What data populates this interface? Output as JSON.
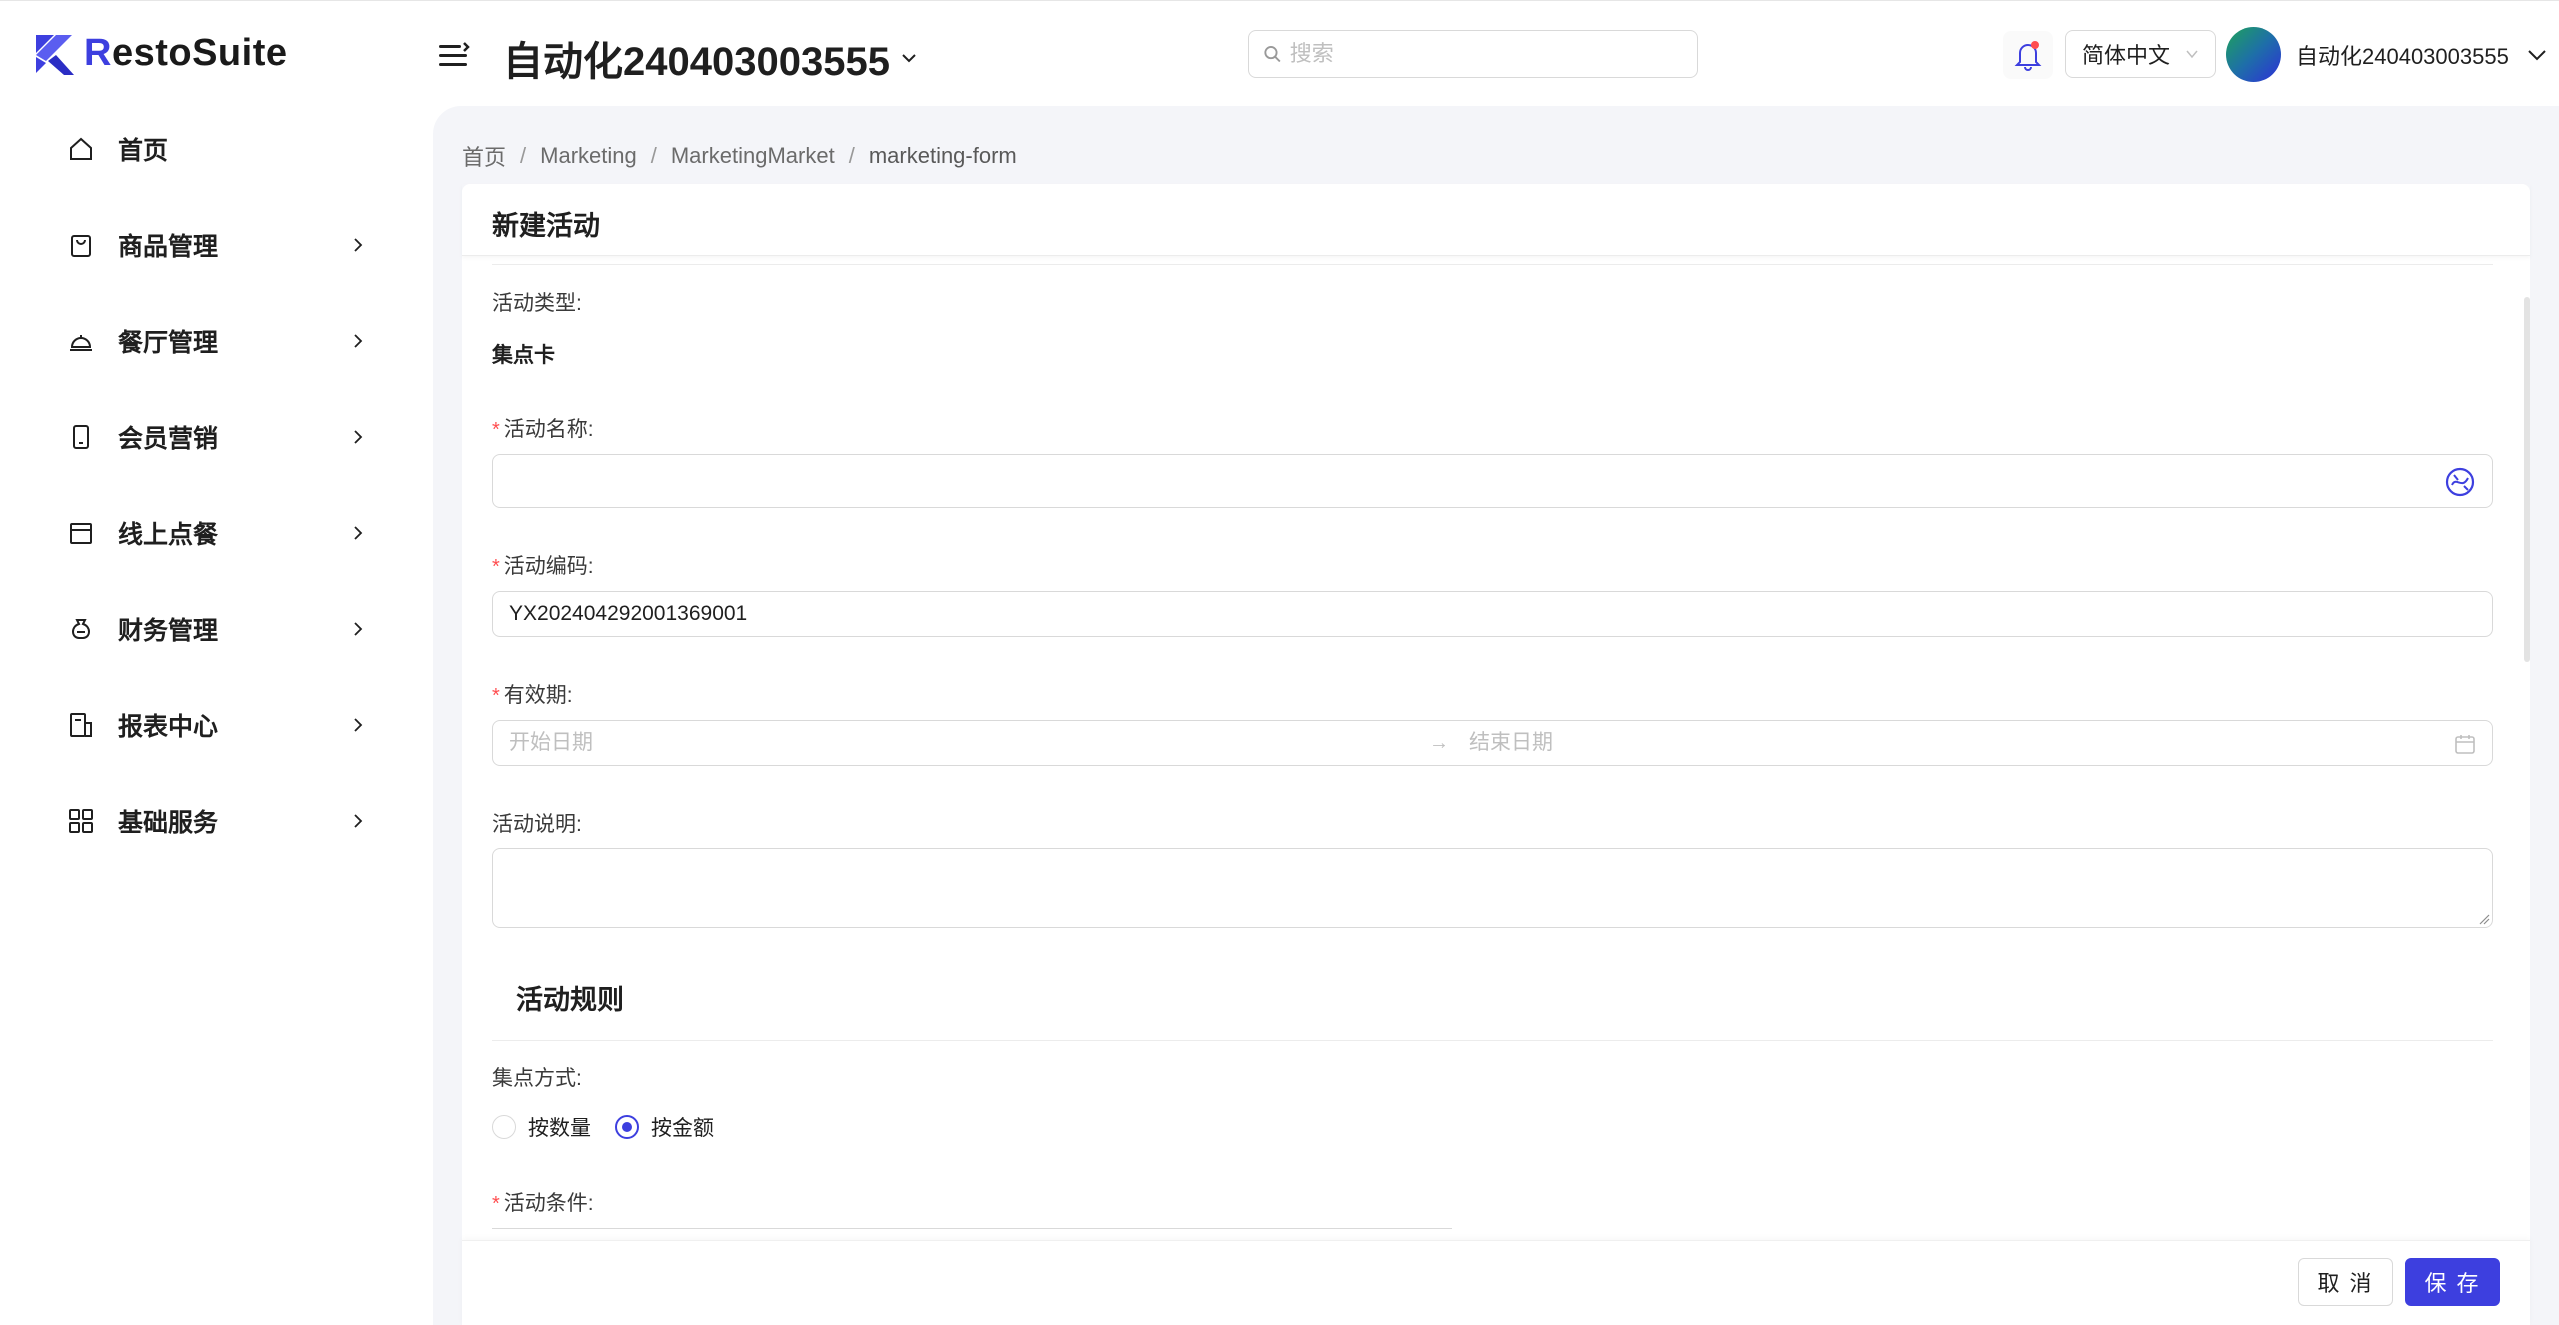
{
  "app": {
    "logo_text_accent": "R",
    "logo_text_rest": "estoSuite",
    "tenant_name": "自动化240403003555",
    "brand_color": "#3d3fdf"
  },
  "header": {
    "search_placeholder": "搜索",
    "language": "简体中文",
    "user_name": "自动化240403003555"
  },
  "sidebar": {
    "items": [
      {
        "label": "首页",
        "icon": "home-icon"
      },
      {
        "label": "商品管理",
        "icon": "shopping-bag-icon"
      },
      {
        "label": "餐厅管理",
        "icon": "service-bell-icon"
      },
      {
        "label": "会员营销",
        "icon": "mobile-icon"
      },
      {
        "label": "线上点餐",
        "icon": "store-icon"
      },
      {
        "label": "财务管理",
        "icon": "money-bag-icon"
      },
      {
        "label": "报表中心",
        "icon": "report-icon"
      },
      {
        "label": "基础服务",
        "icon": "grid-icon"
      }
    ]
  },
  "breadcrumb": [
    "首页",
    "Marketing",
    "MarketingMarket",
    "marketing-form"
  ],
  "form": {
    "title": "新建活动",
    "activity_type_label": "活动类型:",
    "activity_type_value": "集点卡",
    "name_label": "活动名称:",
    "name_value": "",
    "code_label": "活动编码:",
    "code_value": "YX202404292001369001",
    "validity_label": "有效期:",
    "start_placeholder": "开始日期",
    "end_placeholder": "结束日期",
    "desc_label": "活动说明:",
    "desc_value": "",
    "rules_title": "活动规则",
    "collect_method_label": "集点方式:",
    "collect_options": [
      "按数量",
      "按金额"
    ],
    "collect_selected": "按金额",
    "condition_label": "活动条件:"
  },
  "footer": {
    "cancel_label": "取 消",
    "save_label": "保 存"
  }
}
